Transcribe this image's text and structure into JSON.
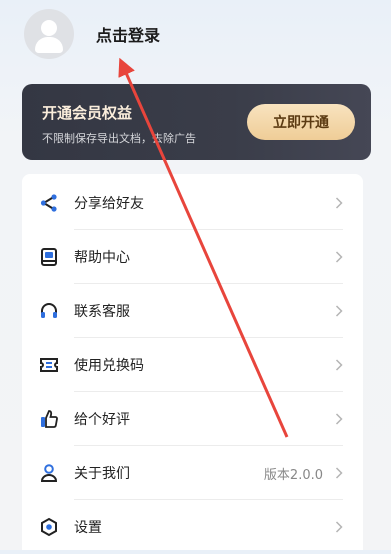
{
  "profile": {
    "login_text": "点击登录"
  },
  "vip": {
    "title": "开通会员权益",
    "subtitle": "不限制保存导出文档，去除广告",
    "button": "立即开通"
  },
  "menu": {
    "items": [
      {
        "label": "分享给好友",
        "icon": "share-icon",
        "value": ""
      },
      {
        "label": "帮助中心",
        "icon": "book-icon",
        "value": ""
      },
      {
        "label": "联系客服",
        "icon": "headset-icon",
        "value": ""
      },
      {
        "label": "使用兑换码",
        "icon": "ticket-icon",
        "value": ""
      },
      {
        "label": "给个好评",
        "icon": "thumbs-up-icon",
        "value": ""
      },
      {
        "label": "关于我们",
        "icon": "person-icon",
        "value": "版本2.0.0"
      },
      {
        "label": "设置",
        "icon": "gear-icon",
        "value": ""
      }
    ]
  },
  "colors": {
    "accent": "#2f6fde",
    "vip_bg": "#363945",
    "vip_button": "#f3d7a8",
    "annotation_arrow": "#e8453c"
  }
}
